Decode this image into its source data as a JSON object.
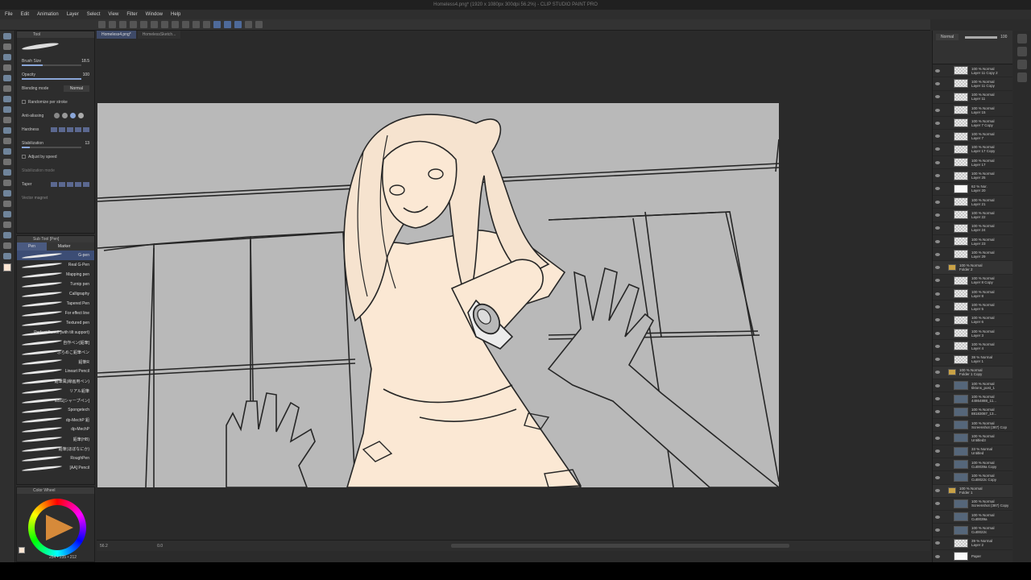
{
  "window": {
    "title": "Homeless4.png* (1920 x 1080px 300dpi 56.2%) - CLIP STUDIO PAINT PRO"
  },
  "menu": [
    "File",
    "Edit",
    "Animation",
    "Layer",
    "Select",
    "View",
    "Filter",
    "Window",
    "Help"
  ],
  "doc_tabs": [
    "Homeless4.png*",
    "HomelessSketch..."
  ],
  "tool_property": {
    "header": "Tool",
    "rows": [
      {
        "label": "Brush Size",
        "value": "18.5",
        "fill": 0.35
      },
      {
        "label": "Opacity",
        "value": "100",
        "fill": 1.0
      },
      {
        "label": "Blending mode",
        "value": "Normal"
      },
      {
        "label": "Randomize per stroke",
        "value": ""
      },
      {
        "label": "Anti-aliasing",
        "value": ""
      },
      {
        "label": "Hardness",
        "value": ""
      },
      {
        "label": "Stabilization",
        "value": "13",
        "fill": 0.13
      },
      {
        "label": "Adjust by speed",
        "value": ""
      },
      {
        "label": "Stabilization mode",
        "value": ""
      },
      {
        "label": "Taper",
        "value": ""
      },
      {
        "label": "Vector magnet",
        "value": ""
      }
    ]
  },
  "sub_tool": {
    "header": "Sub Tool [Pen]",
    "tabs": [
      "Pen",
      "Marker"
    ],
    "brushes": [
      "G-pen",
      "Real G-Pen",
      "Mapping pen",
      "Turnip pen",
      "Calligraphy",
      "Tapered Pen",
      "For effect line",
      "Textured pen",
      "Perfect Pencil (with tilt support)",
      "自作ペン[鉛筆]",
      "ぶらめこ鉛筆ペン",
      "鉛筆R",
      "Lineart Pencil",
      "鉛筆風(線画用ペン)",
      "リアル鉛筆",
      "EBG[シャープペン]",
      "Spongetech",
      "dp-MechP 鉛",
      "dp-MechP",
      "鉛筆(HB)",
      "鉛筆(ほぼなにか)",
      "RoughPen",
      "[AA] Pencil"
    ],
    "selected_index": 0
  },
  "color_wheel": {
    "header": "Color Wheel",
    "rgb_readout": "254 • 235 • 212",
    "main_color": "#fee6d3",
    "sub_color": "#ffffff"
  },
  "status": {
    "zoom": "56.2",
    "angle": "0.0"
  },
  "layer_panel": {
    "blend_mode": "Normal",
    "opacity": "100",
    "layers": [
      {
        "name": "Layer 11 Copy 2",
        "mode": "100 % Normal",
        "kind": "raster"
      },
      {
        "name": "Layer 11 Copy",
        "mode": "100 % Normal",
        "kind": "raster"
      },
      {
        "name": "Layer 11",
        "mode": "100 % Normal",
        "kind": "raster"
      },
      {
        "name": "Layer 15",
        "mode": "100 % Normal",
        "kind": "raster"
      },
      {
        "name": "Layer 7 Copy",
        "mode": "100 % Normal",
        "kind": "raster"
      },
      {
        "name": "Layer 7",
        "mode": "100 % Normal",
        "kind": "raster"
      },
      {
        "name": "Layer 17 Copy",
        "mode": "100 % Normal",
        "kind": "raster"
      },
      {
        "name": "Layer 17",
        "mode": "100 % Normal",
        "kind": "raster"
      },
      {
        "name": "Layer 25",
        "mode": "100 % Normal",
        "kind": "raster"
      },
      {
        "name": "Layer 20",
        "mode": "62 % Nor.",
        "kind": "mask"
      },
      {
        "name": "Layer 21",
        "mode": "100 % Normal",
        "kind": "raster"
      },
      {
        "name": "Layer 22",
        "mode": "100 % Normal",
        "kind": "raster"
      },
      {
        "name": "Layer 24",
        "mode": "100 % Normal",
        "kind": "raster"
      },
      {
        "name": "Layer 23",
        "mode": "100 % Normal",
        "kind": "raster"
      },
      {
        "name": "Layer 29",
        "mode": "100 % Normal",
        "kind": "raster"
      },
      {
        "name": "Folder 2",
        "mode": "100 % Normal",
        "kind": "folder"
      },
      {
        "name": "Layer 8 Copy",
        "mode": "100 % Normal",
        "kind": "raster"
      },
      {
        "name": "Layer 8",
        "mode": "100 % Normal",
        "kind": "raster"
      },
      {
        "name": "Layer 5",
        "mode": "100 % Normal",
        "kind": "raster"
      },
      {
        "name": "Layer 6",
        "mode": "100 % Normal",
        "kind": "raster"
      },
      {
        "name": "Layer 3",
        "mode": "100 % Normal",
        "kind": "raster"
      },
      {
        "name": "Layer 4",
        "mode": "100 % Normal",
        "kind": "raster"
      },
      {
        "name": "Layer 1",
        "mode": "38 % Normal",
        "kind": "raster"
      },
      {
        "name": "Folder 1 Copy",
        "mode": "100 % Normal",
        "kind": "folder"
      },
      {
        "name": "tiktons_post_1",
        "mode": "100 % Normal",
        "kind": "image"
      },
      {
        "name": "44864888_11...",
        "mode": "100 % Normal",
        "kind": "image"
      },
      {
        "name": "88183087_13...",
        "mode": "100 % Normal",
        "kind": "image"
      },
      {
        "name": "Screenshot (387) Cop",
        "mode": "100 % Normal",
        "kind": "image"
      },
      {
        "name": "Untitled3",
        "mode": "100 % Normal",
        "kind": "image"
      },
      {
        "name": "Untitled",
        "mode": "33 % Normal",
        "kind": "image"
      },
      {
        "name": "Cut0039a Copy",
        "mode": "100 % Normal",
        "kind": "image"
      },
      {
        "name": "Cut0022c Copy",
        "mode": "100 % Normal",
        "kind": "image"
      },
      {
        "name": "Folder 1",
        "mode": "100 % Normal",
        "kind": "folder"
      },
      {
        "name": "Screenshot (387) Copy",
        "mode": "100 % Normal",
        "kind": "image"
      },
      {
        "name": "Cut0039a",
        "mode": "100 % Normal",
        "kind": "image"
      },
      {
        "name": "Cut0022c",
        "mode": "100 % Normal",
        "kind": "image"
      },
      {
        "name": "Layer 2",
        "mode": "39 % Normal",
        "kind": "raster"
      },
      {
        "name": "Paper",
        "mode": "",
        "kind": "paper"
      }
    ]
  },
  "colors": {
    "accent": "#4e6a9a",
    "canvas_bg": "#b9b9b9",
    "skin": "#fbe8d4"
  }
}
